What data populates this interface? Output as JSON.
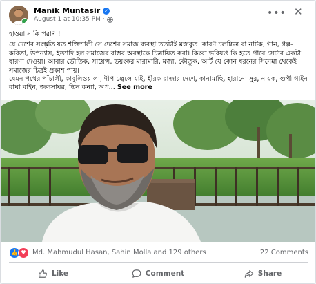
{
  "post": {
    "author": "Manik Muntasir",
    "timestamp": "August 1 at 10:35 PM",
    "menu_icon": "more-horizontal-icon",
    "close_icon": "close-icon",
    "text": {
      "line1": "হাওয়া নাকি পরাণ !",
      "para1": "যে দেশের সংস্কৃতি যত শক্তিশালী সে দেশের সমাজ ব্যবস্থা ততটাই মজবুত। কারণ চলচ্চিত্র বা নাটক, গান, গল্প-কবিতা, উপন্যাস, ইত্যাদি হল সমাজের বাস্তব অবস্থাকে চিত্রায়িত করা। কিংবা ভবিষ্যৎ কি হতে পারে সেটার একটা ধারণা দেওয়া। আবার ভৌতিক, সায়েন্স, ভয়ংকর মারামারি, মজা, কৌতুক, আর্ট যে কোন ধরনের সিনেমা থেকেই সমাজের চিত্রই প্রকাশ পায়।",
      "para2": "যেমন পথের পাঁচালী, কাবুলিওয়ালা, দীপ জ্বেলে যাই, হীরক রাজার দেশে, কানামাছি, হারানো সুর, নায়ক, গুপী গাইন বাঘা বাইন, জলসাঘর, তিন কন্যা, অপ...",
      "see_more": "See more"
    },
    "reactions": {
      "names": "Md. Mahmudul Hasan, Sahin Molla and 129 others",
      "comments": "22 Comments",
      "like_color": "#1877f2",
      "love_color": "#f33e58"
    },
    "actions": {
      "like": "Like",
      "comment": "Comment",
      "share": "Share"
    }
  }
}
